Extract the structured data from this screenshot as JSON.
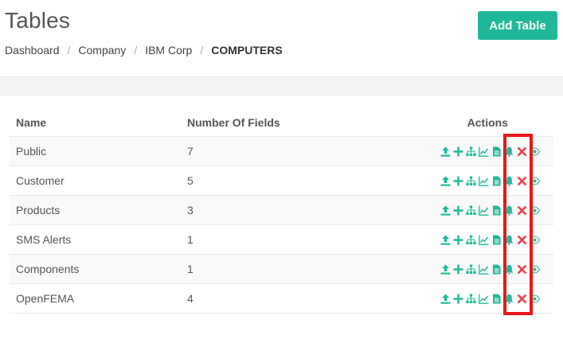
{
  "page": {
    "title": "Tables",
    "add_button": "Add Table"
  },
  "breadcrumb": {
    "items": [
      "Dashboard",
      "Company",
      "IBM Corp",
      "COMPUTERS"
    ],
    "separator": "/"
  },
  "table": {
    "headers": [
      "Name",
      "Number Of Fields",
      "Actions"
    ],
    "rows": [
      {
        "name": "Public",
        "fields": "7"
      },
      {
        "name": "Customer",
        "fields": "5"
      },
      {
        "name": "Products",
        "fields": "3"
      },
      {
        "name": "SMS Alerts",
        "fields": "1"
      },
      {
        "name": "Components",
        "fields": "1"
      },
      {
        "name": "OpenFEMA",
        "fields": "4"
      }
    ],
    "action_icons": [
      "upload-icon",
      "plus-icon",
      "sitemap-icon",
      "line-chart-icon",
      "document-icon",
      "bell-icon",
      "delete-icon",
      "eye-icon"
    ]
  },
  "colors": {
    "accent": "#1fb89a",
    "danger": "#e8434b",
    "highlight": "#e8171c"
  }
}
